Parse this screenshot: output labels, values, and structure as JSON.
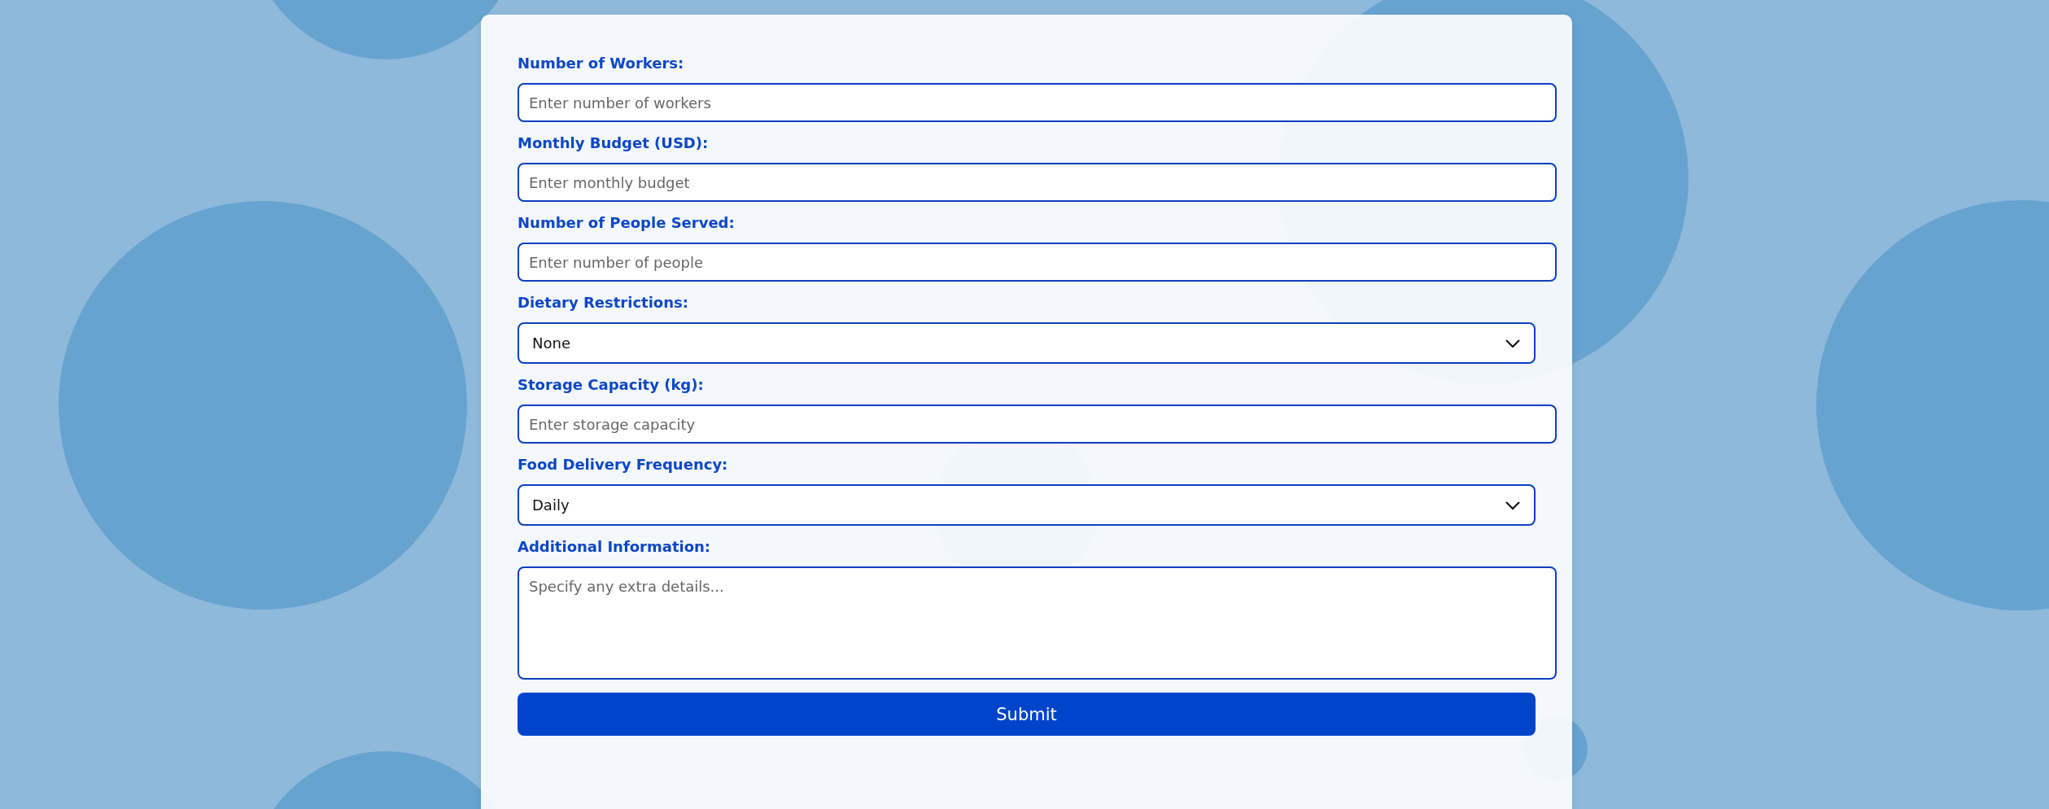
{
  "form": {
    "fields": [
      {
        "kind": "input",
        "label": "Number of Workers:",
        "placeholder": "Enter number of workers"
      },
      {
        "kind": "input",
        "label": "Monthly Budget (USD):",
        "placeholder": "Enter monthly budget"
      },
      {
        "kind": "input",
        "label": "Number of People Served:",
        "placeholder": "Enter number of people"
      },
      {
        "kind": "select",
        "label": "Dietary Restrictions:",
        "value": "None"
      },
      {
        "kind": "input",
        "label": "Storage Capacity (kg):",
        "placeholder": "Enter storage capacity"
      },
      {
        "kind": "select",
        "label": "Food Delivery Frequency:",
        "value": "Daily"
      },
      {
        "kind": "textarea",
        "label": "Additional Information:",
        "placeholder": "Specify any extra details..."
      }
    ],
    "submit": "Submit"
  }
}
